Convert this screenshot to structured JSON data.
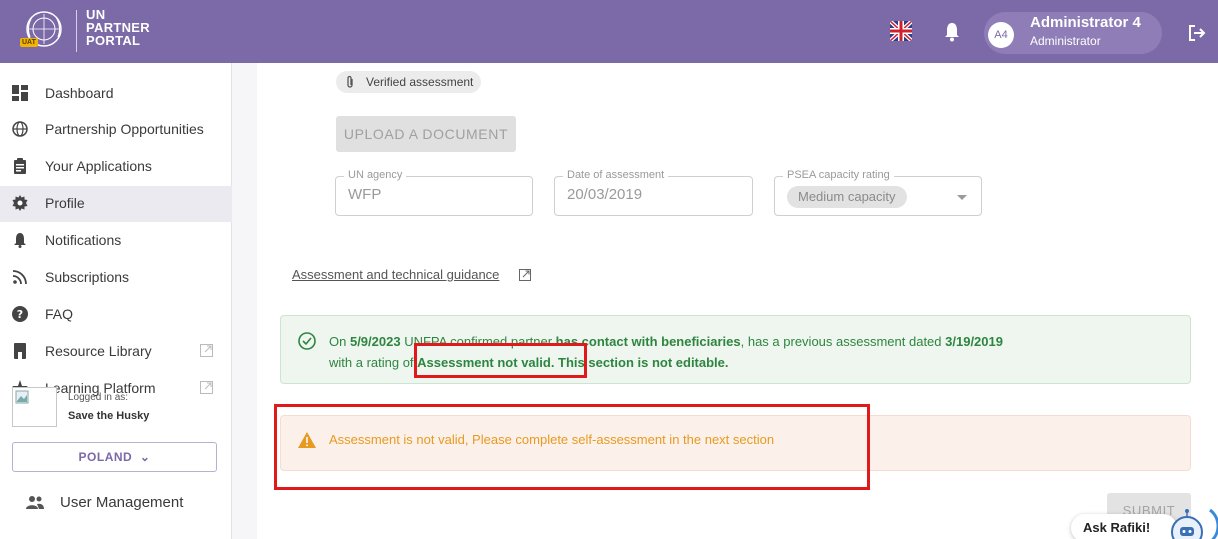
{
  "header": {
    "logo_lines": [
      "UN",
      "PARTNER",
      "PORTAL"
    ],
    "env_badge": "UAT",
    "user_initials": "A4",
    "user_name": "Administrator 4",
    "user_role": "Administrator"
  },
  "sidebar": {
    "items": [
      {
        "label": "Dashboard",
        "icon": "dashboard-icon"
      },
      {
        "label": "Partnership Opportunities",
        "icon": "globe-icon"
      },
      {
        "label": "Your Applications",
        "icon": "clipboard-icon"
      },
      {
        "label": "Profile",
        "icon": "gear-icon",
        "active": true
      },
      {
        "label": "Notifications",
        "icon": "bell-icon"
      },
      {
        "label": "Subscriptions",
        "icon": "rss-icon"
      },
      {
        "label": "FAQ",
        "icon": "help-icon"
      },
      {
        "label": "Resource Library",
        "icon": "book-icon",
        "external": true
      },
      {
        "label": "Learning Platform",
        "icon": "star-icon",
        "external": true
      }
    ],
    "logged_in_label": "Logged in as:",
    "logged_in_name": "Save the Husky",
    "country_label": "POLAND",
    "user_management_label": "User Management"
  },
  "main": {
    "verified_chip": "Verified assessment",
    "upload_label": "UPLOAD A DOCUMENT",
    "fields": {
      "agency": {
        "label": "UN agency",
        "value": "WFP"
      },
      "date": {
        "label": "Date of assessment",
        "value": "20/03/2019"
      },
      "rating": {
        "label": "PSEA capacity rating",
        "value": "Medium capacity"
      }
    },
    "guidance_link": "Assessment and technical guidance",
    "success": {
      "p1": "On ",
      "date1": "5/9/2023",
      "p2": " UNFPA confirmed partner ",
      "b1": "has contact with beneficiaries",
      "p3": ", has a previous assessment dated ",
      "date2": "3/19/2019",
      "p4": " with a rating of ",
      "b2": "Assessment not valid. This section is not editable."
    },
    "warning": "Assessment is not valid, Please complete self-assessment in the next section",
    "submit_label": "SUBMIT",
    "rafiki_label": "Ask Rafiki!"
  },
  "colors": {
    "brand": "#7b69a8",
    "success": "#2e8540",
    "warning": "#e89a20",
    "highlight": "#e01a1a"
  }
}
